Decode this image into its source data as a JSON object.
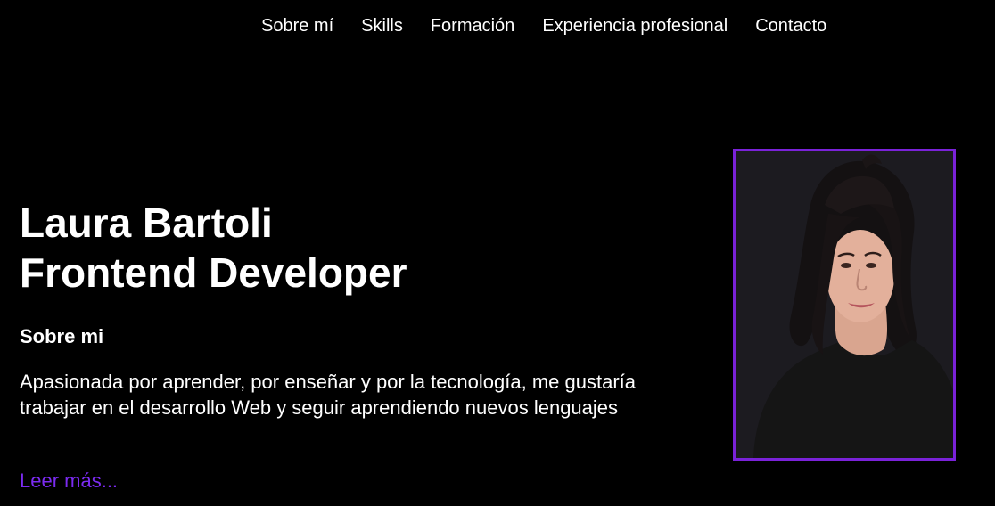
{
  "nav": {
    "items": [
      {
        "label": "Sobre mí"
      },
      {
        "label": "Skills"
      },
      {
        "label": "Formación"
      },
      {
        "label": "Experiencia profesional"
      },
      {
        "label": "Contacto"
      }
    ]
  },
  "hero": {
    "name": "Laura Bartoli",
    "role": "Frontend Developer"
  },
  "about": {
    "heading": "Sobre mi",
    "text": "Apasionada por aprender, por enseñar y por la tecnología, me gustaría trabajar en el desarrollo Web y seguir aprendiendo nuevos lenguajes",
    "read_more": "Leer más..."
  },
  "colors": {
    "background": "#000000",
    "accent": "#7a22d8",
    "link": "#7b2bf0",
    "text": "#ffffff"
  }
}
